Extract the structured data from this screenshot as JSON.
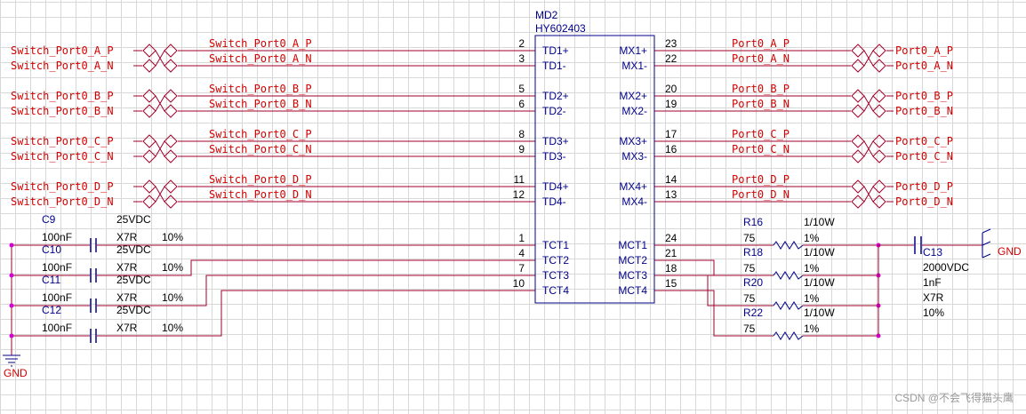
{
  "colors": {
    "wire": "#a0002a",
    "net_label": "#d40000",
    "component": "#00008b",
    "text": "#000000",
    "junction": "#d400d4",
    "grid": "#d8d8d8",
    "watermark": "#9a9a9a"
  },
  "chip": {
    "designator": "MD2",
    "part": "HY602403",
    "left_pins": [
      {
        "num": "2",
        "name": "TD1+"
      },
      {
        "num": "3",
        "name": "TD1-"
      },
      {
        "num": "5",
        "name": "TD2+"
      },
      {
        "num": "6",
        "name": "TD2-"
      },
      {
        "num": "8",
        "name": "TD3+"
      },
      {
        "num": "9",
        "name": "TD3-"
      },
      {
        "num": "11",
        "name": "TD4+"
      },
      {
        "num": "12",
        "name": "TD4-"
      },
      {
        "num": "1",
        "name": "TCT1"
      },
      {
        "num": "4",
        "name": "TCT2"
      },
      {
        "num": "7",
        "name": "TCT3"
      },
      {
        "num": "10",
        "name": "TCT4"
      }
    ],
    "right_pins": [
      {
        "num": "23",
        "name": "MX1+"
      },
      {
        "num": "22",
        "name": "MX1-"
      },
      {
        "num": "20",
        "name": "MX2+"
      },
      {
        "num": "19",
        "name": "MX2-"
      },
      {
        "num": "17",
        "name": "MX3+"
      },
      {
        "num": "16",
        "name": "MX3-"
      },
      {
        "num": "14",
        "name": "MX4+"
      },
      {
        "num": "13",
        "name": "MX4-"
      },
      {
        "num": "24",
        "name": "MCT1"
      },
      {
        "num": "21",
        "name": "MCT2"
      },
      {
        "num": "18",
        "name": "MCT3"
      },
      {
        "num": "15",
        "name": "MCT4"
      }
    ]
  },
  "nets": {
    "switch": [
      "Switch_Port0_A_P",
      "Switch_Port0_A_N",
      "Switch_Port0_B_P",
      "Switch_Port0_B_N",
      "Switch_Port0_C_P",
      "Switch_Port0_C_N",
      "Switch_Port0_D_P",
      "Switch_Port0_D_N"
    ],
    "port": [
      "Port0_A_P",
      "Port0_A_N",
      "Port0_B_P",
      "Port0_B_N",
      "Port0_C_P",
      "Port0_C_N",
      "Port0_D_P",
      "Port0_D_N"
    ]
  },
  "capacitors": [
    {
      "ref": "C9",
      "voltage": "25VDC",
      "value": "100nF",
      "dielectric": "X7R",
      "tolerance": "10%"
    },
    {
      "ref": "C10",
      "voltage": "25VDC",
      "value": "100nF",
      "dielectric": "X7R",
      "tolerance": "10%"
    },
    {
      "ref": "C11",
      "voltage": "25VDC",
      "value": "100nF",
      "dielectric": "X7R",
      "tolerance": "10%"
    },
    {
      "ref": "C12",
      "voltage": "25VDC",
      "value": "100nF",
      "dielectric": "X7R",
      "tolerance": "10%"
    }
  ],
  "resistors": [
    {
      "ref": "R16",
      "value": "75",
      "power": "1/10W",
      "tolerance": "1%"
    },
    {
      "ref": "R18",
      "value": "75",
      "power": "1/10W",
      "tolerance": "1%"
    },
    {
      "ref": "R20",
      "value": "75",
      "power": "1/10W",
      "tolerance": "1%"
    },
    {
      "ref": "R22",
      "value": "75",
      "power": "1/10W",
      "tolerance": "1%"
    }
  ],
  "c13": {
    "ref": "C13",
    "voltage": "2000VDC",
    "value": "1nF",
    "dielectric": "X7R",
    "tolerance": "10%"
  },
  "gnd_label": "GND",
  "watermark": "CSDN @不会飞得猫头鹰"
}
